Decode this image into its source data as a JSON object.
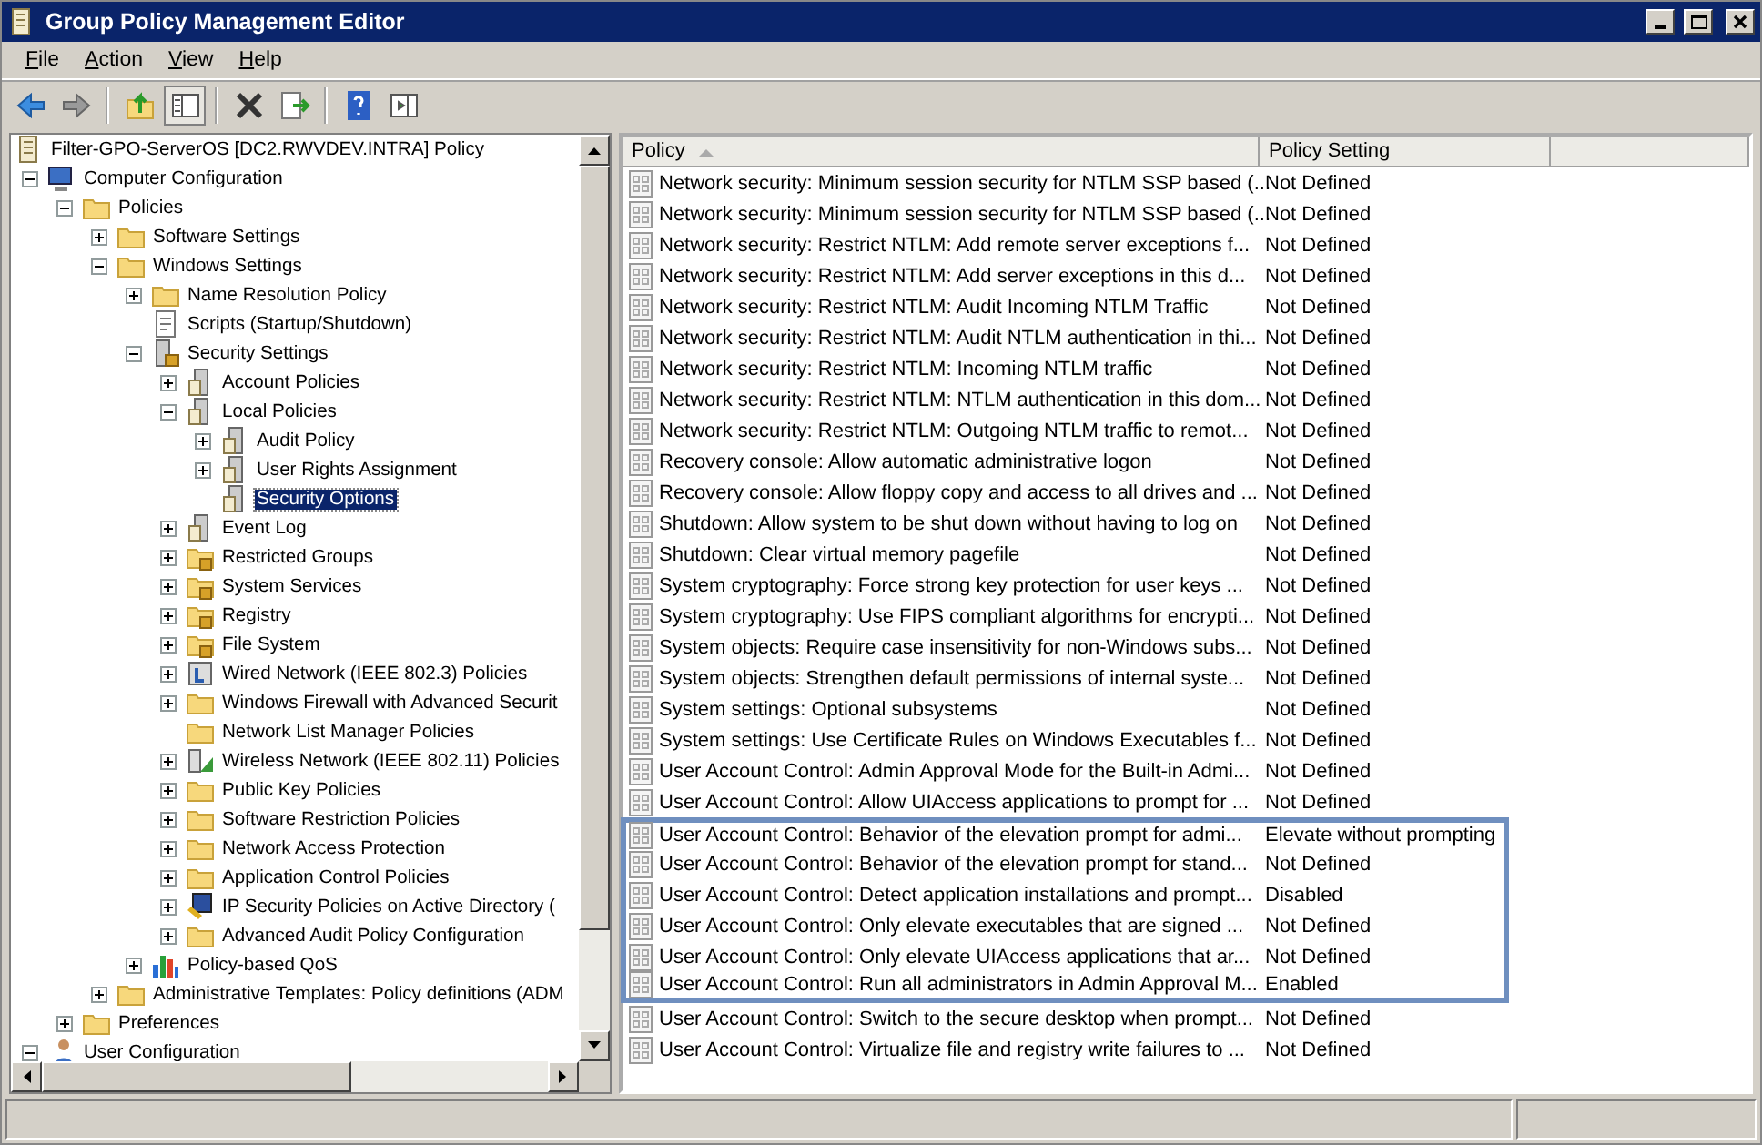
{
  "window": {
    "title": "Group Policy Management Editor"
  },
  "menu": [
    "File",
    "Action",
    "View",
    "Help"
  ],
  "toolbar": [
    {
      "kind": "back"
    },
    {
      "kind": "forward"
    },
    {
      "kind": "separator"
    },
    {
      "kind": "up"
    },
    {
      "kind": "tree",
      "pressed": true
    },
    {
      "kind": "separator"
    },
    {
      "kind": "delete"
    },
    {
      "kind": "export"
    },
    {
      "kind": "separator"
    },
    {
      "kind": "help"
    },
    {
      "kind": "action-pane"
    }
  ],
  "tree": {
    "root": {
      "label": "Filter-GPO-ServerOS [DC2.RWVDEV.INTRA] Policy",
      "kind": "policy"
    },
    "items": [
      {
        "label": "Computer Configuration",
        "kind": "computer",
        "expanded": true,
        "children": [
          {
            "label": "Policies",
            "kind": "folder",
            "expanded": true,
            "children": [
              {
                "label": "Software Settings",
                "kind": "folder",
                "expanded": false
              },
              {
                "label": "Windows Settings",
                "kind": "folder",
                "expanded": true,
                "children": [
                  {
                    "label": "Name Resolution Policy",
                    "kind": "folder",
                    "expanded": false
                  },
                  {
                    "label": "Scripts (Startup/Shutdown)",
                    "kind": "script"
                  },
                  {
                    "label": "Security Settings",
                    "kind": "secure",
                    "expanded": true,
                    "children": [
                      {
                        "label": "Account Policies",
                        "kind": "server",
                        "expanded": false
                      },
                      {
                        "label": "Local Policies",
                        "kind": "server",
                        "expanded": true,
                        "children": [
                          {
                            "label": "Audit Policy",
                            "kind": "server",
                            "expanded": false
                          },
                          {
                            "label": "User Rights Assignment",
                            "kind": "server",
                            "expanded": false
                          },
                          {
                            "label": "Security Options",
                            "kind": "server",
                            "selected": true
                          }
                        ]
                      },
                      {
                        "label": "Event Log",
                        "kind": "server",
                        "expanded": false
                      },
                      {
                        "label": "Restricted Groups",
                        "kind": "locked-folder",
                        "expanded": false
                      },
                      {
                        "label": "System Services",
                        "kind": "locked-folder",
                        "expanded": false
                      },
                      {
                        "label": "Registry",
                        "kind": "locked-folder",
                        "expanded": false
                      },
                      {
                        "label": "File System",
                        "kind": "locked-folder",
                        "expanded": false
                      },
                      {
                        "label": "Wired Network (IEEE 802.3) Policies",
                        "kind": "network",
                        "expanded": false
                      },
                      {
                        "label": "Windows Firewall with Advanced Securit",
                        "kind": "folder",
                        "expanded": false
                      },
                      {
                        "label": "Network List Manager Policies",
                        "kind": "folder"
                      },
                      {
                        "label": "Wireless Network (IEEE 802.11) Policies",
                        "kind": "wireless",
                        "expanded": false
                      },
                      {
                        "label": "Public Key Policies",
                        "kind": "folder",
                        "expanded": false
                      },
                      {
                        "label": "Software Restriction Policies",
                        "kind": "folder",
                        "expanded": false
                      },
                      {
                        "label": "Network Access Protection",
                        "kind": "folder",
                        "expanded": false
                      },
                      {
                        "label": "Application Control Policies",
                        "kind": "folder",
                        "expanded": false
                      },
                      {
                        "label": "IP Security Policies on Active Directory (",
                        "kind": "ipsec",
                        "expanded": false
                      },
                      {
                        "label": "Advanced Audit Policy Configuration",
                        "kind": "folder",
                        "expanded": false
                      }
                    ]
                  },
                  {
                    "label": "Policy-based QoS",
                    "kind": "qos",
                    "expanded": false
                  }
                ]
              },
              {
                "label": "Administrative Templates: Policy definitions (ADM",
                "kind": "folder",
                "expanded": false
              }
            ]
          },
          {
            "label": "Preferences",
            "kind": "folder",
            "expanded": false
          }
        ]
      },
      {
        "label": "User Configuration",
        "kind": "user",
        "expanded": true
      }
    ]
  },
  "table": {
    "columns": [
      {
        "label": "Policy",
        "sorted": true
      },
      {
        "label": "Policy Setting",
        "sorted": false
      }
    ],
    "rows": [
      {
        "policy": "Network security: Minimum session security for NTLM SSP based (...",
        "setting": "Not Defined",
        "highlighted": false
      },
      {
        "policy": "Network security: Minimum session security for NTLM SSP based (...",
        "setting": "Not Defined",
        "highlighted": false
      },
      {
        "policy": "Network security: Restrict NTLM: Add remote server exceptions f...",
        "setting": "Not Defined",
        "highlighted": false
      },
      {
        "policy": "Network security: Restrict NTLM: Add server exceptions in this d...",
        "setting": "Not Defined",
        "highlighted": false
      },
      {
        "policy": "Network security: Restrict NTLM: Audit Incoming NTLM Traffic",
        "setting": "Not Defined",
        "highlighted": false
      },
      {
        "policy": "Network security: Restrict NTLM: Audit NTLM authentication in thi...",
        "setting": "Not Defined",
        "highlighted": false
      },
      {
        "policy": "Network security: Restrict NTLM: Incoming NTLM traffic",
        "setting": "Not Defined",
        "highlighted": false
      },
      {
        "policy": "Network security: Restrict NTLM: NTLM authentication in this dom...",
        "setting": "Not Defined",
        "highlighted": false
      },
      {
        "policy": "Network security: Restrict NTLM: Outgoing NTLM traffic to remot...",
        "setting": "Not Defined",
        "highlighted": false
      },
      {
        "policy": "Recovery console: Allow automatic administrative logon",
        "setting": "Not Defined",
        "highlighted": false
      },
      {
        "policy": "Recovery console: Allow floppy copy and access to all drives and ...",
        "setting": "Not Defined",
        "highlighted": false
      },
      {
        "policy": "Shutdown: Allow system to be shut down without having to log on",
        "setting": "Not Defined",
        "highlighted": false
      },
      {
        "policy": "Shutdown: Clear virtual memory pagefile",
        "setting": "Not Defined",
        "highlighted": false
      },
      {
        "policy": "System cryptography: Force strong key protection for user keys ...",
        "setting": "Not Defined",
        "highlighted": false
      },
      {
        "policy": "System cryptography: Use FIPS compliant algorithms for encrypti...",
        "setting": "Not Defined",
        "highlighted": false
      },
      {
        "policy": "System objects: Require case insensitivity for non-Windows subs...",
        "setting": "Not Defined",
        "highlighted": false
      },
      {
        "policy": "System objects: Strengthen default permissions of internal syste...",
        "setting": "Not Defined",
        "highlighted": false
      },
      {
        "policy": "System settings: Optional subsystems",
        "setting": "Not Defined",
        "highlighted": false
      },
      {
        "policy": "System settings: Use Certificate Rules on Windows Executables f...",
        "setting": "Not Defined",
        "highlighted": false
      },
      {
        "policy": "User Account Control: Admin Approval Mode for the Built-in Admi...",
        "setting": "Not Defined",
        "highlighted": false
      },
      {
        "policy": "User Account Control: Allow UIAccess applications to prompt for ...",
        "setting": "Not Defined",
        "highlighted": false
      },
      {
        "policy": "User Account Control: Behavior of the elevation prompt for admi...",
        "setting": "Elevate without prompting",
        "highlighted": true
      },
      {
        "policy": "User Account Control: Behavior of the elevation prompt for stand...",
        "setting": "Not Defined",
        "highlighted": true
      },
      {
        "policy": "User Account Control: Detect application installations and prompt...",
        "setting": "Disabled",
        "highlighted": true
      },
      {
        "policy": "User Account Control: Only elevate executables that are signed ...",
        "setting": "Not Defined",
        "highlighted": true
      },
      {
        "policy": "User Account Control: Only elevate UIAccess applications that ar...",
        "setting": "Not Defined",
        "highlighted": true
      },
      {
        "policy": "User Account Control: Run all administrators in Admin Approval M...",
        "setting": "Enabled",
        "highlighted": true
      },
      {
        "policy": "User Account Control: Switch to the secure desktop when prompt...",
        "setting": "Not Defined",
        "highlighted": false
      },
      {
        "policy": "User Account Control: Virtualize file and registry write failures to ...",
        "setting": "Not Defined",
        "highlighted": false
      }
    ]
  }
}
